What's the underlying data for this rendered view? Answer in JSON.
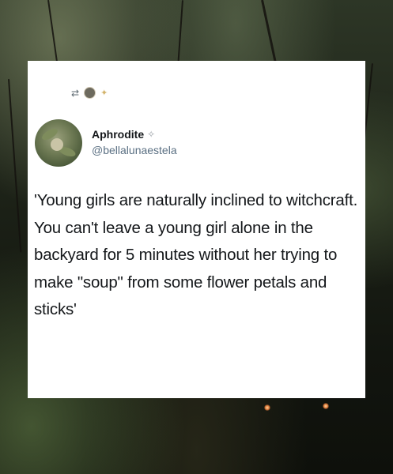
{
  "post": {
    "author_name": "Aphrodite",
    "author_handle": "@bellalunaestela",
    "text": "'Young girls are naturally inclined to witchcraft. You can't leave a young girl alone in the backyard for 5 minutes without her trying to make \"soup\" from some flower petals and sticks'"
  },
  "icons": {
    "retweet": "retweet-icon",
    "retweeter_avatar": "retweeter-avatar",
    "sparkle": "sparkle-icon",
    "fairy": "fairy-emoji-icon",
    "avatar": "profile-avatar"
  },
  "colors": {
    "card_background": "#ffffff",
    "text": "#14171a",
    "handle": "#5b7083"
  }
}
